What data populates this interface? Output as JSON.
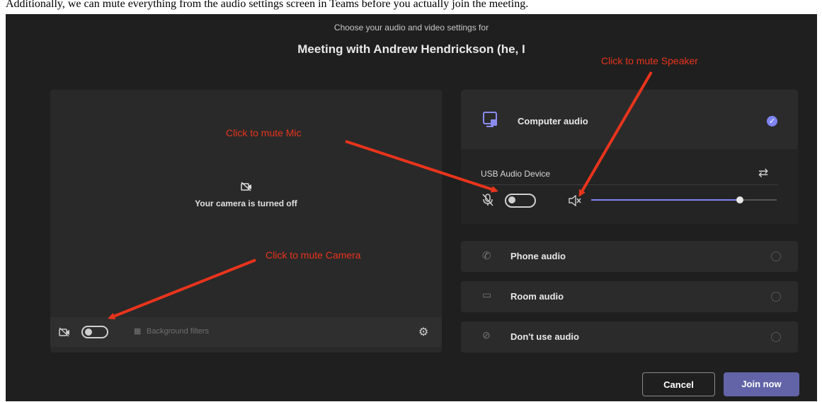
{
  "top_text": "Additionally, we can mute everything from the audio settings screen in Teams before you actually join the meeting.",
  "header": {
    "subtitle": "Choose your audio and video settings for",
    "meeting_title": "Meeting with Andrew Hendrickson (he, I"
  },
  "video": {
    "camera_status": "Your camera is turned off",
    "background_filters": "Background filters"
  },
  "audio": {
    "computer_audio": "Computer audio",
    "device_name": "USB Audio Device",
    "speaker_volume": 0.8,
    "phone_audio": "Phone audio",
    "room_audio": "Room audio",
    "no_audio": "Don't use audio",
    "accent": "#6264a7"
  },
  "annotations": {
    "mute_speaker": "Click to mute Speaker",
    "mute_mic": "Click to mute Mic",
    "mute_camera": "Click to mute Camera",
    "color": "#e8341c"
  },
  "footer": {
    "cancel": "Cancel",
    "join": "Join now"
  }
}
